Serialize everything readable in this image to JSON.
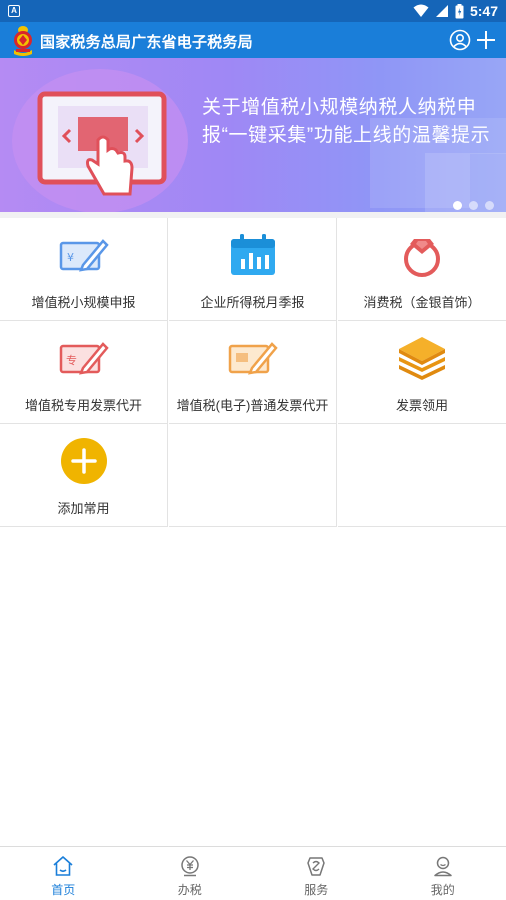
{
  "status_bar": {
    "notification_icon": "a-box-icon",
    "time": "5:47",
    "icons": [
      "wifi-icon",
      "signal-icon",
      "battery-icon"
    ]
  },
  "app_bar": {
    "title": "国家税务总局广东省电子税务局",
    "emblem_icon": "tax-emblem-icon",
    "actions": [
      "user-circle-icon",
      "plus-icon"
    ]
  },
  "banner": {
    "headline": "关于增值税小规模纳税人纳税申报“一键采集”功能上线的温馨提示",
    "page_count": 3,
    "active_index": 0
  },
  "grid": {
    "items": [
      {
        "label": "增值税小规模申报",
        "icon": "invoice-pen-icon",
        "color": "#5a97e8"
      },
      {
        "label": "企业所得税月季报",
        "icon": "calendar-chart-icon",
        "color": "#2fa9f0"
      },
      {
        "label": "消费税（金银首饰）",
        "icon": "diamond-ring-icon",
        "color": "#e35b5b"
      },
      {
        "label": "增值税专用发票代开",
        "icon": "special-invoice-pen-icon",
        "color": "#e35b5b"
      },
      {
        "label": "增值税(电子)普通发票代开",
        "icon": "e-invoice-pen-icon",
        "color": "#f0a24a"
      },
      {
        "label": "发票领用",
        "icon": "stacked-layers-icon",
        "color": "#f0a21a"
      },
      {
        "label": "添加常用",
        "icon": "add-circle-icon",
        "color": "#f0b400"
      }
    ]
  },
  "bottom_nav": {
    "items": [
      {
        "label": "首页",
        "icon": "home-icon",
        "active": true
      },
      {
        "label": "办税",
        "icon": "yen-coin-icon",
        "active": false
      },
      {
        "label": "服务",
        "icon": "service-icon",
        "active": false
      },
      {
        "label": "我的",
        "icon": "person-icon",
        "active": false
      }
    ]
  },
  "colors": {
    "primary": "#1a7ed9",
    "status_bar": "#1565b8",
    "active_tab": "#1a7ed9"
  }
}
